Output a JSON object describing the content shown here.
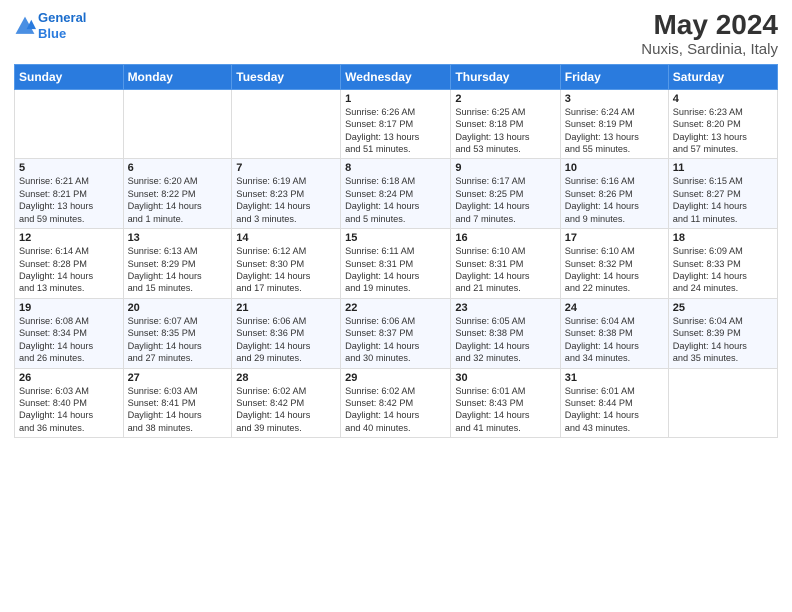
{
  "header": {
    "logo_line1": "General",
    "logo_line2": "Blue",
    "main_title": "May 2024",
    "subtitle": "Nuxis, Sardinia, Italy"
  },
  "days_of_week": [
    "Sunday",
    "Monday",
    "Tuesday",
    "Wednesday",
    "Thursday",
    "Friday",
    "Saturday"
  ],
  "weeks": [
    [
      {
        "num": "",
        "info": ""
      },
      {
        "num": "",
        "info": ""
      },
      {
        "num": "",
        "info": ""
      },
      {
        "num": "1",
        "info": "Sunrise: 6:26 AM\nSunset: 8:17 PM\nDaylight: 13 hours\nand 51 minutes."
      },
      {
        "num": "2",
        "info": "Sunrise: 6:25 AM\nSunset: 8:18 PM\nDaylight: 13 hours\nand 53 minutes."
      },
      {
        "num": "3",
        "info": "Sunrise: 6:24 AM\nSunset: 8:19 PM\nDaylight: 13 hours\nand 55 minutes."
      },
      {
        "num": "4",
        "info": "Sunrise: 6:23 AM\nSunset: 8:20 PM\nDaylight: 13 hours\nand 57 minutes."
      }
    ],
    [
      {
        "num": "5",
        "info": "Sunrise: 6:21 AM\nSunset: 8:21 PM\nDaylight: 13 hours\nand 59 minutes."
      },
      {
        "num": "6",
        "info": "Sunrise: 6:20 AM\nSunset: 8:22 PM\nDaylight: 14 hours\nand 1 minute."
      },
      {
        "num": "7",
        "info": "Sunrise: 6:19 AM\nSunset: 8:23 PM\nDaylight: 14 hours\nand 3 minutes."
      },
      {
        "num": "8",
        "info": "Sunrise: 6:18 AM\nSunset: 8:24 PM\nDaylight: 14 hours\nand 5 minutes."
      },
      {
        "num": "9",
        "info": "Sunrise: 6:17 AM\nSunset: 8:25 PM\nDaylight: 14 hours\nand 7 minutes."
      },
      {
        "num": "10",
        "info": "Sunrise: 6:16 AM\nSunset: 8:26 PM\nDaylight: 14 hours\nand 9 minutes."
      },
      {
        "num": "11",
        "info": "Sunrise: 6:15 AM\nSunset: 8:27 PM\nDaylight: 14 hours\nand 11 minutes."
      }
    ],
    [
      {
        "num": "12",
        "info": "Sunrise: 6:14 AM\nSunset: 8:28 PM\nDaylight: 14 hours\nand 13 minutes."
      },
      {
        "num": "13",
        "info": "Sunrise: 6:13 AM\nSunset: 8:29 PM\nDaylight: 14 hours\nand 15 minutes."
      },
      {
        "num": "14",
        "info": "Sunrise: 6:12 AM\nSunset: 8:30 PM\nDaylight: 14 hours\nand 17 minutes."
      },
      {
        "num": "15",
        "info": "Sunrise: 6:11 AM\nSunset: 8:31 PM\nDaylight: 14 hours\nand 19 minutes."
      },
      {
        "num": "16",
        "info": "Sunrise: 6:10 AM\nSunset: 8:31 PM\nDaylight: 14 hours\nand 21 minutes."
      },
      {
        "num": "17",
        "info": "Sunrise: 6:10 AM\nSunset: 8:32 PM\nDaylight: 14 hours\nand 22 minutes."
      },
      {
        "num": "18",
        "info": "Sunrise: 6:09 AM\nSunset: 8:33 PM\nDaylight: 14 hours\nand 24 minutes."
      }
    ],
    [
      {
        "num": "19",
        "info": "Sunrise: 6:08 AM\nSunset: 8:34 PM\nDaylight: 14 hours\nand 26 minutes."
      },
      {
        "num": "20",
        "info": "Sunrise: 6:07 AM\nSunset: 8:35 PM\nDaylight: 14 hours\nand 27 minutes."
      },
      {
        "num": "21",
        "info": "Sunrise: 6:06 AM\nSunset: 8:36 PM\nDaylight: 14 hours\nand 29 minutes."
      },
      {
        "num": "22",
        "info": "Sunrise: 6:06 AM\nSunset: 8:37 PM\nDaylight: 14 hours\nand 30 minutes."
      },
      {
        "num": "23",
        "info": "Sunrise: 6:05 AM\nSunset: 8:38 PM\nDaylight: 14 hours\nand 32 minutes."
      },
      {
        "num": "24",
        "info": "Sunrise: 6:04 AM\nSunset: 8:38 PM\nDaylight: 14 hours\nand 34 minutes."
      },
      {
        "num": "25",
        "info": "Sunrise: 6:04 AM\nSunset: 8:39 PM\nDaylight: 14 hours\nand 35 minutes."
      }
    ],
    [
      {
        "num": "26",
        "info": "Sunrise: 6:03 AM\nSunset: 8:40 PM\nDaylight: 14 hours\nand 36 minutes."
      },
      {
        "num": "27",
        "info": "Sunrise: 6:03 AM\nSunset: 8:41 PM\nDaylight: 14 hours\nand 38 minutes."
      },
      {
        "num": "28",
        "info": "Sunrise: 6:02 AM\nSunset: 8:42 PM\nDaylight: 14 hours\nand 39 minutes."
      },
      {
        "num": "29",
        "info": "Sunrise: 6:02 AM\nSunset: 8:42 PM\nDaylight: 14 hours\nand 40 minutes."
      },
      {
        "num": "30",
        "info": "Sunrise: 6:01 AM\nSunset: 8:43 PM\nDaylight: 14 hours\nand 41 minutes."
      },
      {
        "num": "31",
        "info": "Sunrise: 6:01 AM\nSunset: 8:44 PM\nDaylight: 14 hours\nand 43 minutes."
      },
      {
        "num": "",
        "info": ""
      }
    ]
  ]
}
